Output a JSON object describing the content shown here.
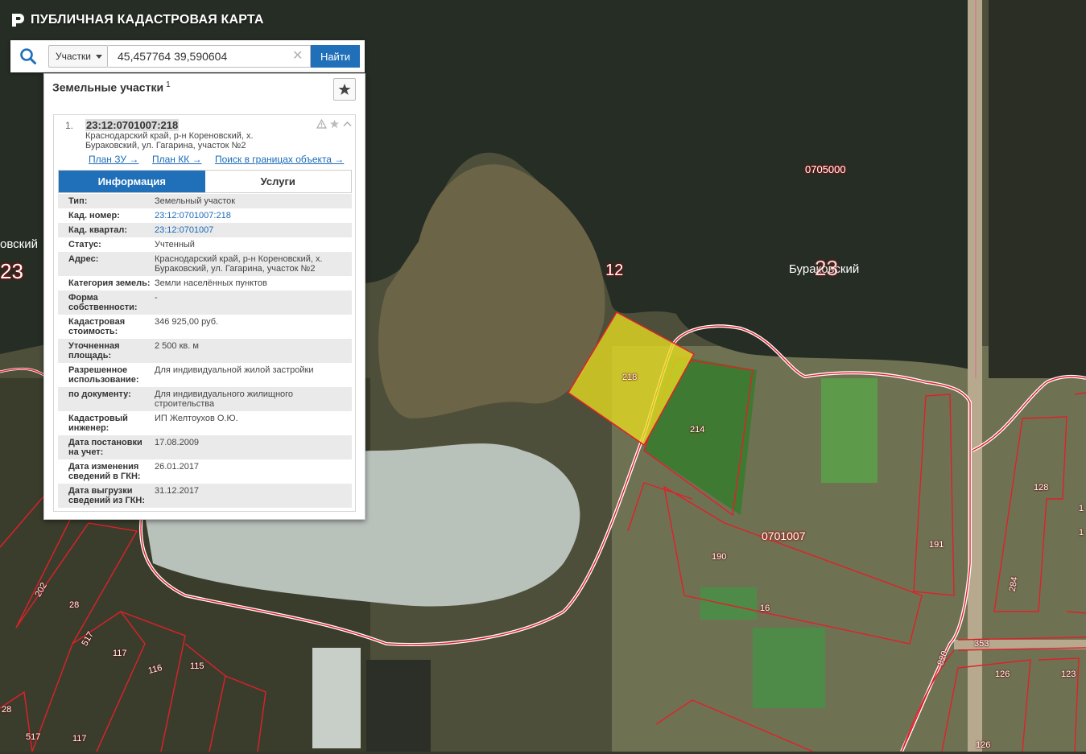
{
  "app": {
    "title": "ПУБЛИЧНАЯ КАДАСТРОВАЯ КАРТА",
    "logo_icon": "rosreestr-logo-icon"
  },
  "search": {
    "icon": "search-icon",
    "type_selected": "Участки",
    "value": "45,457764 39,590604",
    "clear_icon": "close-icon",
    "button_label": "Найти"
  },
  "panel": {
    "title": "Земельные участки",
    "count": "1",
    "favorite_icon": "star-icon"
  },
  "result": {
    "index": "1.",
    "cad_number": "23:12:0701007:218",
    "address": "Краснодарский край, р-н Кореновский, х. Бураковский, ул. Гагарина, участок №2",
    "links": {
      "plan_zu": "План ЗУ →",
      "plan_kk": "План КК →",
      "search_in_bounds": "Поиск в границах объекта →"
    },
    "icons": [
      "warning-icon",
      "star-icon",
      "chevron-up-icon"
    ]
  },
  "tabs": [
    {
      "label": "Информация",
      "active": true
    },
    {
      "label": "Услуги",
      "active": false
    }
  ],
  "info": [
    {
      "key": "Тип:",
      "value": "Земельный участок",
      "link": false
    },
    {
      "key": "Кад. номер:",
      "value": "23:12:0701007:218",
      "link": true
    },
    {
      "key": "Кад. квартал:",
      "value": "23:12:0701007",
      "link": true
    },
    {
      "key": "Статус:",
      "value": "Учтенный",
      "link": false
    },
    {
      "key": "Адрес:",
      "value": "Краснодарский край, р-н Кореновский, х. Бураковский, ул. Гагарина, участок №2",
      "link": false
    },
    {
      "key": "Категория земель:",
      "value": "Земли населённых пунктов",
      "link": false
    },
    {
      "key": "Форма собственности:",
      "value": "-",
      "link": false
    },
    {
      "key": "Кадастровая стоимость:",
      "value": "346 925,00 руб.",
      "link": false
    },
    {
      "key": "Уточненная площадь:",
      "value": "2 500 кв. м",
      "link": false
    },
    {
      "key": "Разрешенное использование:",
      "value": "Для индивидуальной жилой застройки",
      "link": false
    },
    {
      "key": "по документу:",
      "value": "Для индивидуального жилищного строительства",
      "link": false
    },
    {
      "key": "Кадастровый инженер:",
      "value": "ИП Желтоухов О.Ю.",
      "link": false
    },
    {
      "key": "Дата постановки на учет:",
      "value": "17.08.2009",
      "link": false
    },
    {
      "key": "Дата изменения сведений в ГКН:",
      "value": "26.01.2017",
      "link": false
    },
    {
      "key": "Дата выгрузки сведений из ГКН:",
      "value": "31.12.2017",
      "link": false
    }
  ],
  "map": {
    "colors": {
      "water": "#262d25",
      "field": "#6b6e50",
      "border": "#e0202a",
      "selected_fill": "#e6dd20"
    },
    "place_names": {
      "left_district": "овский",
      "left_number": "23",
      "center_number": "12",
      "village": "Бураковский",
      "village_number": "23"
    },
    "quarters": {
      "north": "0705000",
      "south": "0701007"
    },
    "plots": {
      "selected": "218",
      "p214": "214",
      "p190": "190",
      "p16": "16",
      "p191": "191",
      "p128": "128",
      "p284": "284",
      "p353": "353",
      "p820": "820",
      "p126a": "126",
      "p123": "123",
      "p126b": "126",
      "p202": "202",
      "p28a": "28",
      "p517a": "517",
      "p117a": "117",
      "p116": "116",
      "p115": "115",
      "p28b": "28",
      "p517b": "517",
      "p117b": "117",
      "p1": "1",
      "p1b": "1"
    }
  }
}
